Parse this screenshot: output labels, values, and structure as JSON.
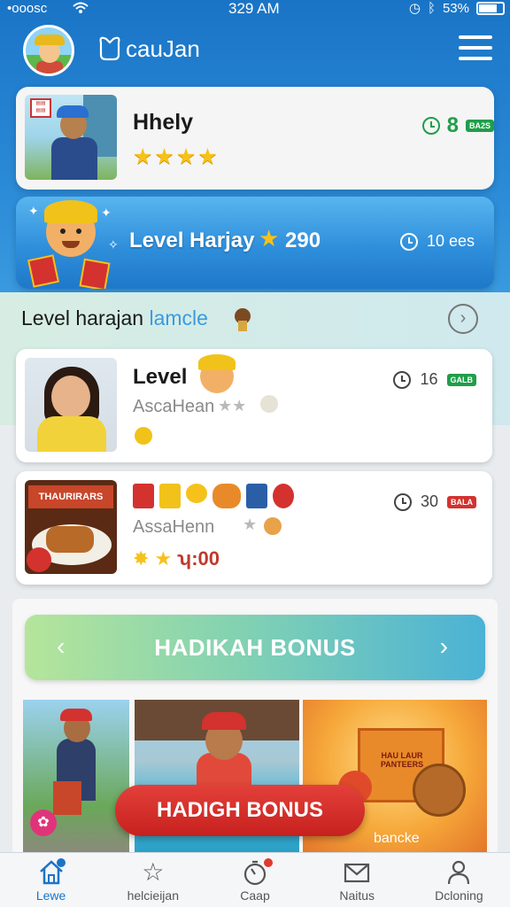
{
  "status_bar": {
    "carrier": "•ooosc",
    "time": "329 AM",
    "battery": "53%"
  },
  "header": {
    "brand": "cauJan"
  },
  "profile": {
    "name": "Hhely",
    "rating": 4,
    "stat_value": "8",
    "stat_badge": "BA2S"
  },
  "level_banner": {
    "title": "Level Harjay",
    "score": "290",
    "stat": "10 ees"
  },
  "section": {
    "title_main": "Level harajan",
    "title_accent": "lamcle"
  },
  "cards": [
    {
      "title": "Level",
      "subtitle": "AscaHean",
      "stat": "16",
      "badge": "GALB"
    },
    {
      "sign": "THAURIRARS",
      "subtitle": "AssaHenn",
      "reward": "ʮ:00",
      "stat": "30",
      "badge": "BALA"
    }
  ],
  "bonus": {
    "title": "HADIKAH BONUS",
    "pill": "HADIGH BONUS",
    "tile3_label": "bancke",
    "tile3_box": "HAU LAUR PANTEERS"
  },
  "bottom_nav": [
    {
      "label": "Lewe",
      "icon": "home-icon"
    },
    {
      "label": "helcieijan",
      "icon": "star-icon"
    },
    {
      "label": "Caap",
      "icon": "stopwatch-icon"
    },
    {
      "label": "Naitus",
      "icon": "mail-icon"
    },
    {
      "label": "Dcloning",
      "icon": "user-icon"
    }
  ],
  "colors": {
    "primary_blue": "#1a74c6",
    "accent_green": "#1f9e4a",
    "accent_red": "#d3322f",
    "star_gold": "#f6c21a"
  }
}
